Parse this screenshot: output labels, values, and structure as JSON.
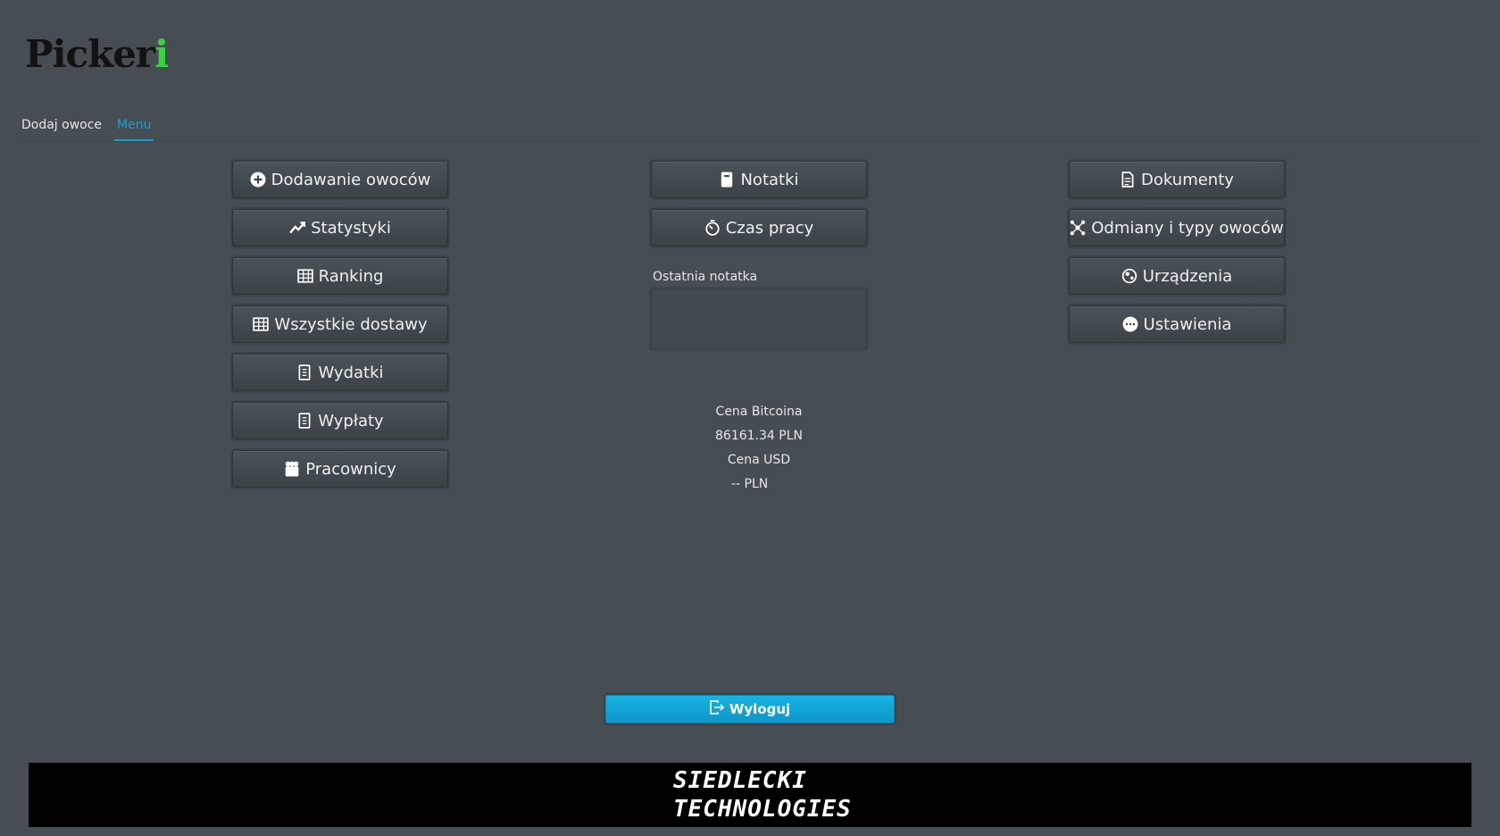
{
  "app": {
    "logo_main": "Picker",
    "logo_accent": "i",
    "logo_accent_color": "#39d43e"
  },
  "tabs": [
    {
      "label": "Dodaj owoce",
      "active": false
    },
    {
      "label": "Menu",
      "active": true
    }
  ],
  "left_buttons": [
    {
      "label": "Dodawanie owoców",
      "icon": "plus-circle-icon"
    },
    {
      "label": "Statystyki",
      "icon": "chart-line-icon"
    },
    {
      "label": "Ranking",
      "icon": "table-icon"
    },
    {
      "label": "Wszystkie dostawy",
      "icon": "table-icon"
    },
    {
      "label": "Wydatki",
      "icon": "receipt-icon"
    },
    {
      "label": "Wypłaty",
      "icon": "receipt-icon"
    },
    {
      "label": "Pracownicy",
      "icon": "people-icon"
    }
  ],
  "center_buttons": [
    {
      "label": "Notatki",
      "icon": "notebook-icon"
    },
    {
      "label": "Czas pracy",
      "icon": "stopwatch-icon"
    }
  ],
  "right_buttons": [
    {
      "label": "Dokumenty",
      "icon": "document-icon"
    },
    {
      "label": "Odmiany i typy owoców",
      "icon": "nodes-icon"
    },
    {
      "label": "Urządzenia",
      "icon": "devices-icon"
    },
    {
      "label": "Ustawienia",
      "icon": "more-circle-icon"
    }
  ],
  "notes": {
    "label": "Ostatnia notatka",
    "value": ""
  },
  "prices": {
    "btc_label": "Cena Bitcoina",
    "btc_value": "86161.34 PLN",
    "usd_label": "Cena USD",
    "usd_value": "-- PLN"
  },
  "logout": {
    "label": "Wyloguj",
    "icon": "logout-icon",
    "color": "#17b4e4"
  },
  "footer": {
    "line1": "SIEDLECKI",
    "line2": "TECHNOLOGIES"
  }
}
